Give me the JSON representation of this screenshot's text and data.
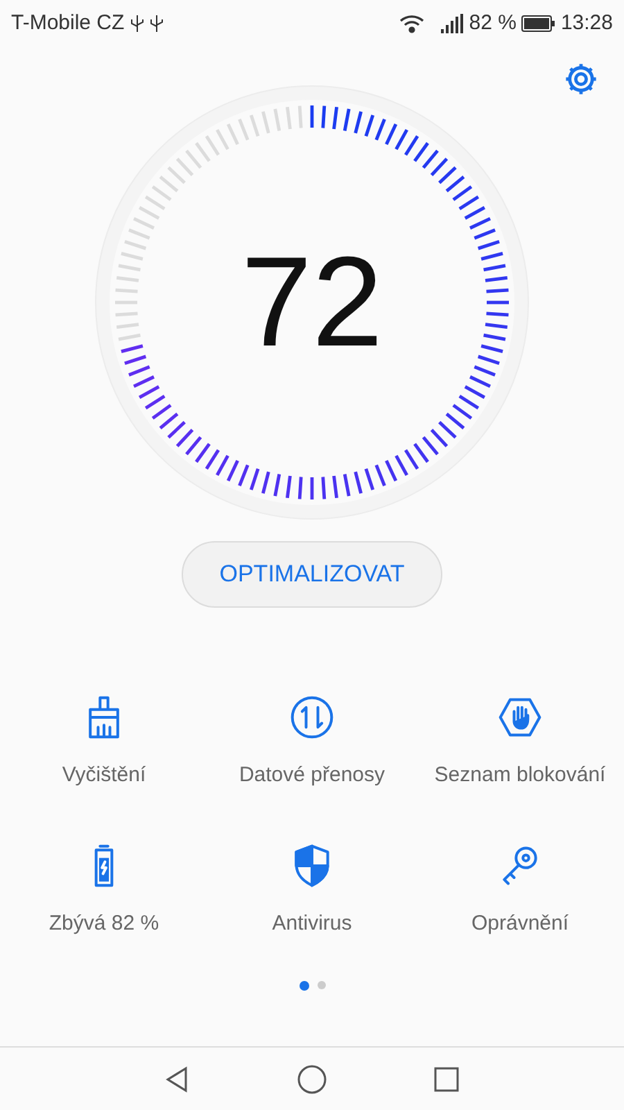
{
  "status_bar": {
    "carrier": "T-Mobile CZ",
    "battery_text": "82 %",
    "time": "13:28"
  },
  "gauge": {
    "score": "72"
  },
  "optimize_button": "OPTIMALIZOVAT",
  "tools": [
    {
      "kind": "cleanup",
      "label": "Vyčištění"
    },
    {
      "kind": "data",
      "label": "Datové přenosy"
    },
    {
      "kind": "blocklist",
      "label": "Seznam blokování"
    },
    {
      "kind": "battery",
      "label": "Zbývá 82 %"
    },
    {
      "kind": "antivirus",
      "label": "Antivirus"
    },
    {
      "kind": "permissions",
      "label": "Oprávnění"
    }
  ],
  "pages": [
    {
      "selected": true
    },
    {
      "selected": false
    }
  ]
}
